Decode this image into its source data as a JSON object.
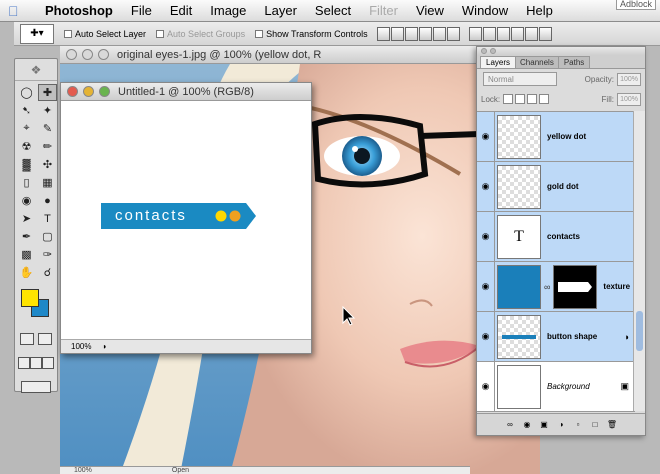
{
  "menubar": {
    "app_name": "Photoshop",
    "items": [
      "File",
      "Edit",
      "Image",
      "Layer",
      "Select",
      "Filter",
      "View",
      "Window",
      "Help"
    ],
    "adblock": "Adblock"
  },
  "options_bar": {
    "auto_select_layer": "Auto Select Layer",
    "auto_select_groups": "Auto Select Groups",
    "show_transform_controls": "Show Transform Controls"
  },
  "toolbox": {
    "foreground_color": "#ffe400",
    "background_color": "#1e88c8"
  },
  "photo_window": {
    "title": "original eyes-1.jpg @ 100% (yellow dot, R"
  },
  "doc_window": {
    "title": "Untitled-1 @ 100% (RGB/8)",
    "zoom": "100%",
    "button_label": "contacts",
    "button_color": "#1a8ac2",
    "dot_colors": [
      "#ffd800",
      "#f0a020"
    ]
  },
  "layers_panel": {
    "tabs": [
      "Layers",
      "Channels",
      "Paths"
    ],
    "blend_mode": "Normal",
    "opacity_label": "Opacity:",
    "opacity_value": "100%",
    "lock_label": "Lock:",
    "fill_label": "Fill:",
    "fill_value": "100%",
    "layers": [
      {
        "name": "yellow dot"
      },
      {
        "name": "gold dot"
      },
      {
        "name": "contacts",
        "type_glyph": "T"
      },
      {
        "name": "texture"
      },
      {
        "name": "button shape"
      },
      {
        "name": "Background"
      }
    ]
  },
  "bottom_strip": {
    "zoom": "100%",
    "label": "Open"
  }
}
